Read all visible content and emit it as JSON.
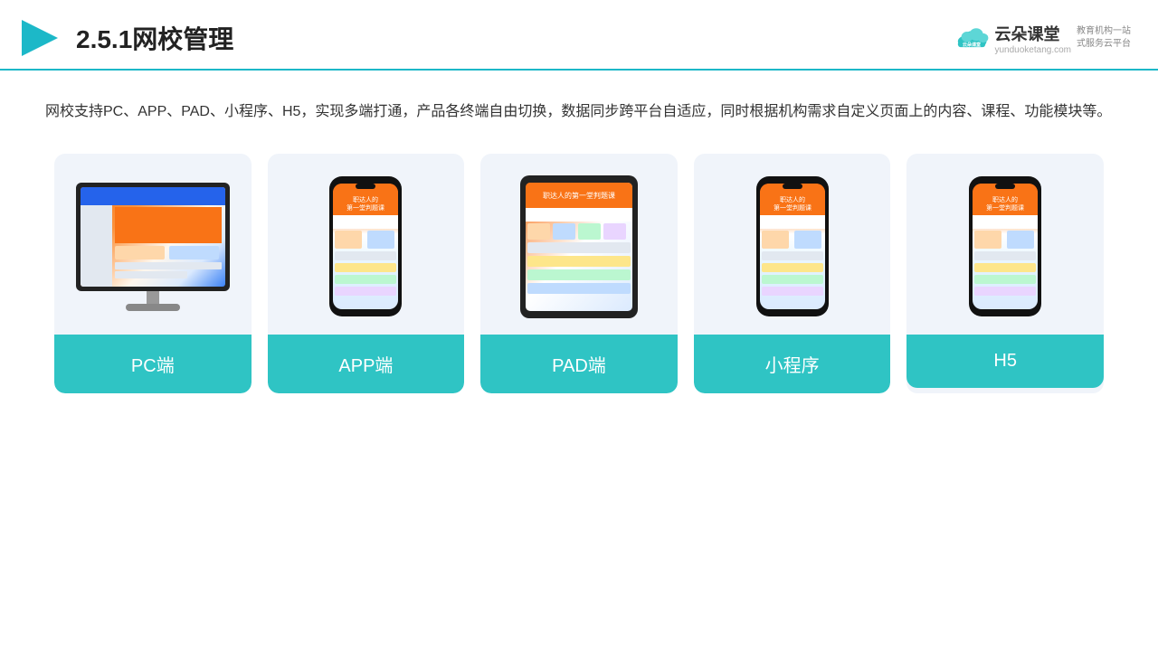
{
  "header": {
    "section_number": "2.5.1",
    "title": "网校管理",
    "logo_name": "云朵课堂",
    "logo_url": "yunduoketang.com",
    "logo_tagline": "教育机构一站\n式服务云平台"
  },
  "description": {
    "text": "网校支持PC、APP、PAD、小程序、H5，实现多端打通，产品各终端自由切换，数据同步跨平台自适应，同时根据机构需求自定义页面上的内容、课程、功能模块等。"
  },
  "cards": [
    {
      "id": "pc",
      "label": "PC端"
    },
    {
      "id": "app",
      "label": "APP端"
    },
    {
      "id": "pad",
      "label": "PAD端"
    },
    {
      "id": "miniprogram",
      "label": "小程序"
    },
    {
      "id": "h5",
      "label": "H5"
    }
  ],
  "colors": {
    "teal": "#2fc4c4",
    "header_line": "#1cb8c8",
    "card_bg": "#f0f4fa",
    "title_color": "#222",
    "text_color": "#333"
  }
}
